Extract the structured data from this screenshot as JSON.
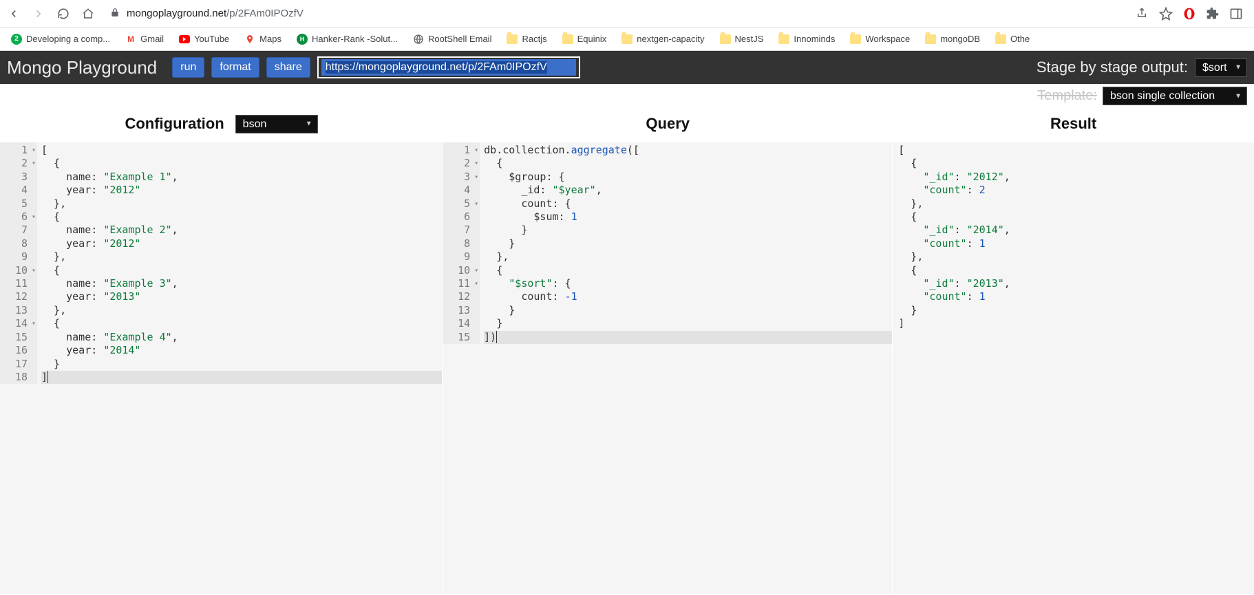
{
  "browser": {
    "url_domain": "mongoplayground.net",
    "url_path": "/p/2FAm0IPOzfV"
  },
  "bookmarks": [
    {
      "label": "Developing a comp...",
      "icon": "green-circle"
    },
    {
      "label": "Gmail",
      "icon": "gmail"
    },
    {
      "label": "YouTube",
      "icon": "youtube"
    },
    {
      "label": "Maps",
      "icon": "maps"
    },
    {
      "label": "Hanker-Rank -Solut...",
      "icon": "hr"
    },
    {
      "label": "RootShell Email",
      "icon": "globe"
    },
    {
      "label": "Ractjs",
      "icon": "folder"
    },
    {
      "label": "Equinix",
      "icon": "folder"
    },
    {
      "label": "nextgen-capacity",
      "icon": "folder"
    },
    {
      "label": "NestJS",
      "icon": "folder"
    },
    {
      "label": "Innominds",
      "icon": "folder"
    },
    {
      "label": "Workspace",
      "icon": "folder"
    },
    {
      "label": "mongoDB",
      "icon": "folder"
    },
    {
      "label": "Othe",
      "icon": "folder"
    }
  ],
  "app": {
    "title": "Mongo Playground",
    "run_label": "run",
    "format_label": "format",
    "share_label": "share",
    "share_url": "https://mongoplayground.net/p/2FAm0IPOzfV",
    "stage_label": "Stage by stage output:",
    "stage_value": "$sort",
    "template_label": "Template:",
    "template_value": "bson single collection"
  },
  "panels": {
    "config_title": "Configuration",
    "config_mode": "bson",
    "query_title": "Query",
    "result_title": "Result"
  },
  "config_lines": [
    {
      "n": 1,
      "fold": true,
      "text": "["
    },
    {
      "n": 2,
      "fold": true,
      "text": "  {"
    },
    {
      "n": 3,
      "text": "    name: \"Example 1\","
    },
    {
      "n": 4,
      "text": "    year: \"2012\""
    },
    {
      "n": 5,
      "text": "  },"
    },
    {
      "n": 6,
      "fold": true,
      "text": "  {"
    },
    {
      "n": 7,
      "text": "    name: \"Example 2\","
    },
    {
      "n": 8,
      "text": "    year: \"2012\""
    },
    {
      "n": 9,
      "text": "  },"
    },
    {
      "n": 10,
      "fold": true,
      "text": "  {"
    },
    {
      "n": 11,
      "text": "    name: \"Example 3\","
    },
    {
      "n": 12,
      "text": "    year: \"2013\""
    },
    {
      "n": 13,
      "text": "  },"
    },
    {
      "n": 14,
      "fold": true,
      "text": "  {"
    },
    {
      "n": 15,
      "text": "    name: \"Example 4\","
    },
    {
      "n": 16,
      "text": "    year: \"2014\""
    },
    {
      "n": 17,
      "text": "  }"
    },
    {
      "n": 18,
      "text": "]"
    }
  ],
  "query_lines": [
    {
      "n": 1,
      "fold": true,
      "segments": [
        {
          "t": "db",
          "c": "dbobj"
        },
        {
          "t": ".collection."
        },
        {
          "t": "aggregate",
          "c": "fn"
        },
        {
          "t": "(["
        }
      ]
    },
    {
      "n": 2,
      "fold": true,
      "segments": [
        {
          "t": "  {"
        }
      ]
    },
    {
      "n": 3,
      "fold": true,
      "segments": [
        {
          "t": "    $group: {"
        }
      ]
    },
    {
      "n": 4,
      "segments": [
        {
          "t": "      _id: "
        },
        {
          "t": "\"$year\"",
          "c": "str"
        },
        {
          "t": ","
        }
      ]
    },
    {
      "n": 5,
      "fold": true,
      "segments": [
        {
          "t": "      count: {"
        }
      ]
    },
    {
      "n": 6,
      "segments": [
        {
          "t": "        $sum: "
        },
        {
          "t": "1",
          "c": "num"
        }
      ]
    },
    {
      "n": 7,
      "segments": [
        {
          "t": "      }"
        }
      ]
    },
    {
      "n": 8,
      "segments": [
        {
          "t": "    }"
        }
      ]
    },
    {
      "n": 9,
      "segments": [
        {
          "t": "  },"
        }
      ]
    },
    {
      "n": 10,
      "fold": true,
      "segments": [
        {
          "t": "  {"
        }
      ]
    },
    {
      "n": 11,
      "fold": true,
      "segments": [
        {
          "t": "    "
        },
        {
          "t": "\"$sort\"",
          "c": "str"
        },
        {
          "t": ": {"
        }
      ]
    },
    {
      "n": 12,
      "segments": [
        {
          "t": "      count: "
        },
        {
          "t": "-1",
          "c": "num"
        }
      ]
    },
    {
      "n": 13,
      "segments": [
        {
          "t": "    }"
        }
      ]
    },
    {
      "n": 14,
      "segments": [
        {
          "t": "  }"
        }
      ]
    },
    {
      "n": 15,
      "hl": true,
      "segments": [
        {
          "t": "])"
        }
      ]
    }
  ],
  "result_lines": [
    {
      "segments": [
        {
          "t": "["
        }
      ]
    },
    {
      "segments": [
        {
          "t": "  {"
        }
      ]
    },
    {
      "segments": [
        {
          "t": "    "
        },
        {
          "t": "\"_id\"",
          "c": "key"
        },
        {
          "t": ": "
        },
        {
          "t": "\"2012\"",
          "c": "val"
        },
        {
          "t": ","
        }
      ]
    },
    {
      "segments": [
        {
          "t": "    "
        },
        {
          "t": "\"count\"",
          "c": "key"
        },
        {
          "t": ": "
        },
        {
          "t": "2",
          "c": "numv"
        }
      ]
    },
    {
      "segments": [
        {
          "t": "  },"
        }
      ]
    },
    {
      "segments": [
        {
          "t": "  {"
        }
      ]
    },
    {
      "segments": [
        {
          "t": "    "
        },
        {
          "t": "\"_id\"",
          "c": "key"
        },
        {
          "t": ": "
        },
        {
          "t": "\"2014\"",
          "c": "val"
        },
        {
          "t": ","
        }
      ]
    },
    {
      "segments": [
        {
          "t": "    "
        },
        {
          "t": "\"count\"",
          "c": "key"
        },
        {
          "t": ": "
        },
        {
          "t": "1",
          "c": "numv"
        }
      ]
    },
    {
      "segments": [
        {
          "t": "  },"
        }
      ]
    },
    {
      "segments": [
        {
          "t": "  {"
        }
      ]
    },
    {
      "segments": [
        {
          "t": "    "
        },
        {
          "t": "\"_id\"",
          "c": "key"
        },
        {
          "t": ": "
        },
        {
          "t": "\"2013\"",
          "c": "val"
        },
        {
          "t": ","
        }
      ]
    },
    {
      "segments": [
        {
          "t": "    "
        },
        {
          "t": "\"count\"",
          "c": "key"
        },
        {
          "t": ": "
        },
        {
          "t": "1",
          "c": "numv"
        }
      ]
    },
    {
      "segments": [
        {
          "t": "  }"
        }
      ]
    },
    {
      "segments": [
        {
          "t": "]"
        }
      ]
    }
  ]
}
